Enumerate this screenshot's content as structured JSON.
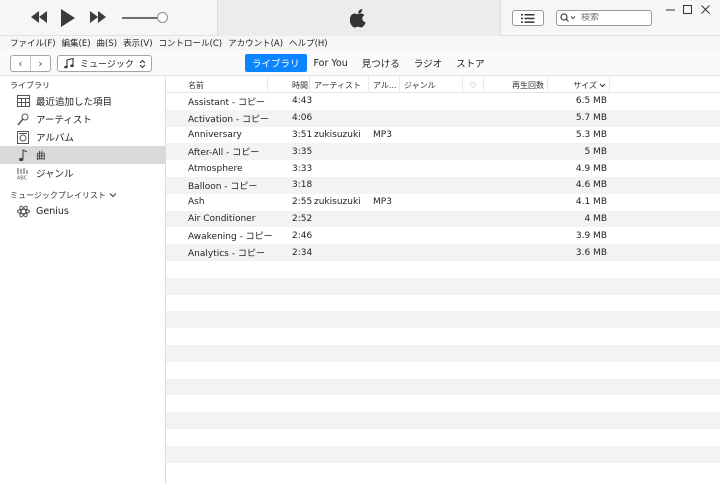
{
  "player": {
    "prev_icon": "rewind-icon",
    "play_icon": "play-icon",
    "next_icon": "fast-forward-icon",
    "logo_icon": "apple-logo-icon"
  },
  "search": {
    "placeholder": "検索"
  },
  "window_controls": [
    "minimize-icon",
    "maximize-icon",
    "close-icon"
  ],
  "menubar": {
    "items": [
      "ファイル(F)",
      "編集(E)",
      "曲(S)",
      "表示(V)",
      "コントロール(C)",
      "アカウント(A)",
      "ヘルプ(H)"
    ]
  },
  "navbar": {
    "media_type": "ミュージック",
    "tabs": [
      "ライブラリ",
      "For You",
      "見つける",
      "ラジオ",
      "ストア"
    ],
    "active_tab": "ライブラリ"
  },
  "sidebar": {
    "library_heading": "ライブラリ",
    "library_items": [
      {
        "label": "最近追加した項目",
        "icon": "calendar-grid-icon"
      },
      {
        "label": "アーティスト",
        "icon": "microphone-icon"
      },
      {
        "label": "アルバム",
        "icon": "album-icon"
      },
      {
        "label": "曲",
        "icon": "music-note-icon",
        "selected": true
      },
      {
        "label": "ジャンル",
        "icon": "genre-icon"
      }
    ],
    "playlists_heading": "ミュージックプレイリスト",
    "playlist_items": [
      {
        "label": "Genius",
        "icon": "genius-atom-icon"
      }
    ]
  },
  "table": {
    "columns": {
      "name": "名前",
      "time": "時間",
      "artist": "アーティスト",
      "album": "アル...",
      "genre": "ジャンル",
      "loved": "♡",
      "plays": "再生回数",
      "size": "サイズ"
    },
    "sort_indicator": "chevron-down-icon",
    "rows": [
      {
        "name": "Assistant - コピー",
        "time": "4:43",
        "artist": "",
        "album": "",
        "size": "6.5 MB"
      },
      {
        "name": "Activation - コピー",
        "time": "4:06",
        "artist": "",
        "album": "",
        "size": "5.7 MB"
      },
      {
        "name": "Anniversary",
        "time": "3:51",
        "artist": "zukisuzuki",
        "album": "MP3",
        "size": "5.3 MB"
      },
      {
        "name": "After-All - コピー",
        "time": "3:35",
        "artist": "",
        "album": "",
        "size": "5 MB"
      },
      {
        "name": "Atmosphere",
        "time": "3:33",
        "artist": "",
        "album": "",
        "size": "4.9 MB"
      },
      {
        "name": "Balloon - コピー",
        "time": "3:18",
        "artist": "",
        "album": "",
        "size": "4.6 MB"
      },
      {
        "name": "Ash",
        "time": "2:55",
        "artist": "zukisuzuki",
        "album": "MP3",
        "size": "4.1 MB"
      },
      {
        "name": "Air Conditioner",
        "time": "2:52",
        "artist": "",
        "album": "",
        "size": "4 MB"
      },
      {
        "name": "Awakening - コピー",
        "time": "2:46",
        "artist": "",
        "album": "",
        "size": "3.9 MB"
      },
      {
        "name": "Analytics - コピー",
        "time": "2:34",
        "artist": "",
        "album": "",
        "size": "3.6 MB"
      }
    ],
    "empty_rows": 13
  }
}
